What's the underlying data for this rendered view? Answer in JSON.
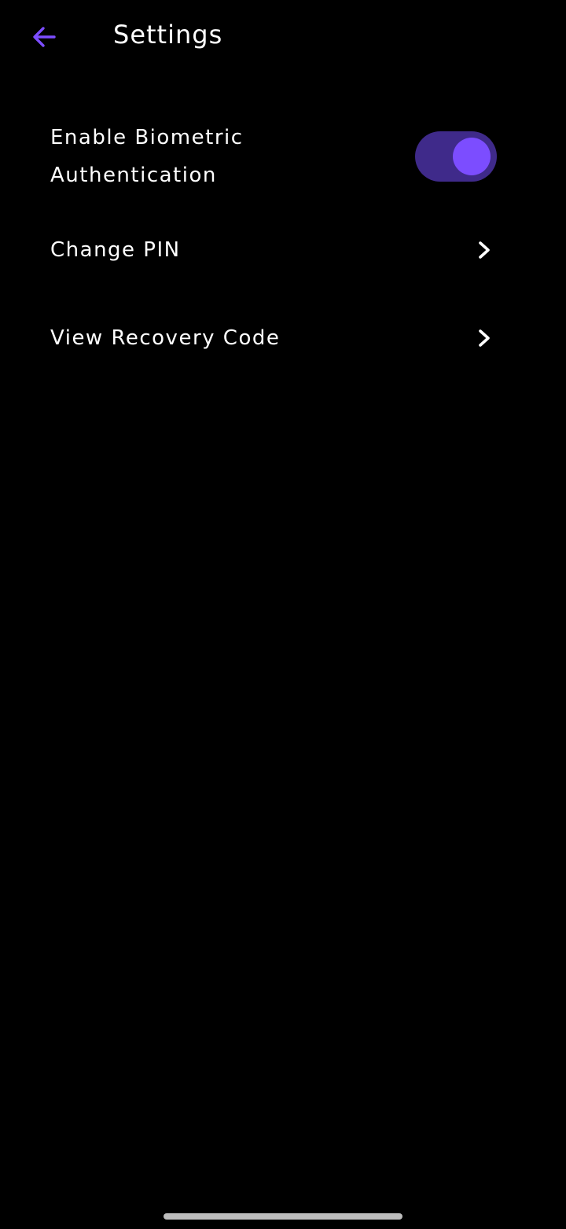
{
  "header": {
    "title": "Settings",
    "back_icon": "arrow-left-icon"
  },
  "settings": {
    "biometric": {
      "label": "Enable Biometric Authentication",
      "enabled": true
    },
    "change_pin": {
      "label": "Change PIN",
      "icon": "chevron-right-icon"
    },
    "recovery_code": {
      "label": "View Recovery Code",
      "icon": "chevron-right-icon"
    }
  },
  "colors": {
    "background": "#000000",
    "text": "#ffffff",
    "accent": "#7c4dff",
    "toggle_track_on": "#3f2a8a",
    "toggle_knob_on": "#7c4dff"
  }
}
